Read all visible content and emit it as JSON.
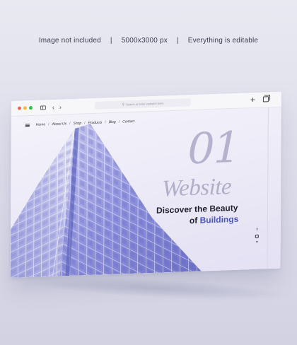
{
  "caption": {
    "left": "Image not included",
    "center": "5000x3000 px",
    "right": "Everything is editable",
    "separator": "|"
  },
  "browser": {
    "address_placeholder": "Search or enter website name",
    "traffic_lights": [
      "#ff5f57",
      "#febc2e",
      "#28c840"
    ],
    "icons": [
      "sidebar-icon",
      "back-icon",
      "forward-icon",
      "search-icon",
      "new-tab-icon",
      "tabs-overview-icon"
    ]
  },
  "site": {
    "nav": {
      "items": [
        "Home",
        "About Us",
        "Shop",
        "Products",
        "Blog",
        "Contact"
      ],
      "separator": "/"
    },
    "hero": {
      "number": "01",
      "word": "Website",
      "tagline_line1": "Discover the Beauty",
      "tagline_line2_prefix": "of",
      "tagline_line2_accent": "Buildings"
    },
    "social_icons": [
      "facebook-icon",
      "instagram-icon",
      "twitter-icon"
    ],
    "colors": {
      "accent": "#4a56c8",
      "display_text": "#b0aec8",
      "glass": "#7b80d6"
    }
  }
}
